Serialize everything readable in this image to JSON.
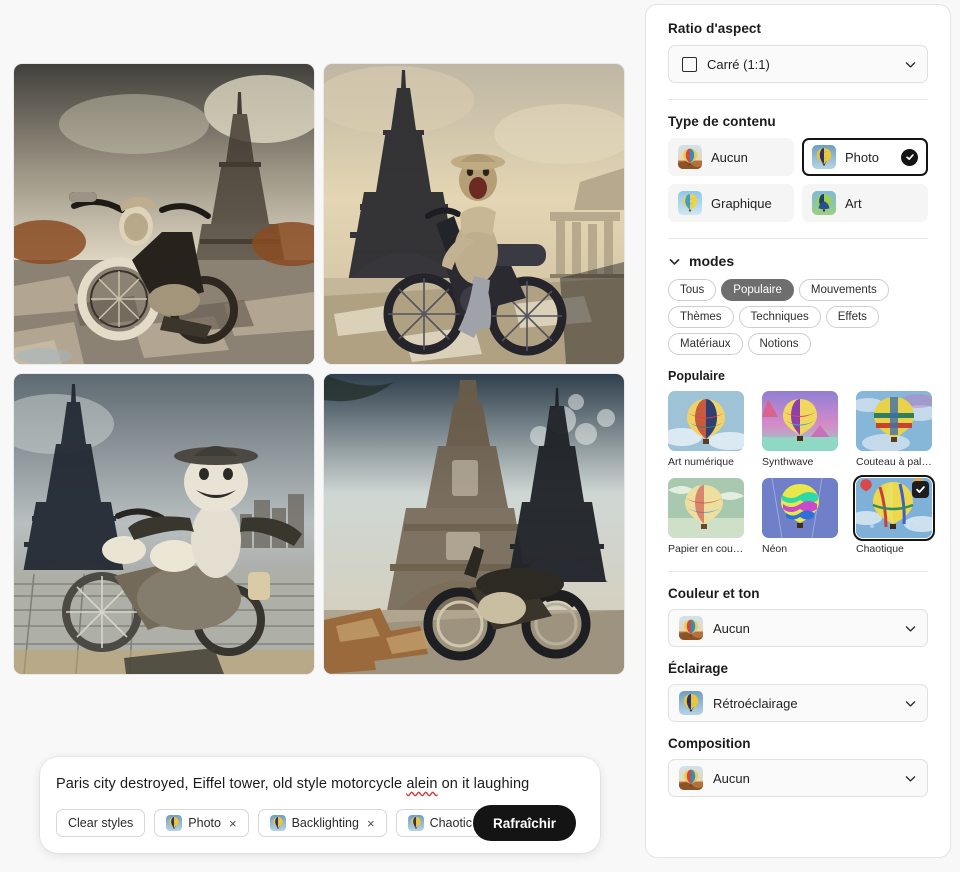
{
  "results": {
    "images": [
      {
        "alt": "Paris destroyed with Eiffel tower and old style motorcycle, rider laughing, sepia tone"
      },
      {
        "alt": "Laughing character riding motorcycle in front of Eiffel tower with ruins"
      },
      {
        "alt": "Puppet character with hat on motorcycle near Eiffel tower, misty"
      },
      {
        "alt": "Two Eiffel towers with motorcycle and debris, blue sky"
      }
    ]
  },
  "prompt": {
    "text_before": "Paris city destroyed, Eiffel tower, old style motorcycle ",
    "misspelled_word": "alein",
    "text_after": " on it laughing",
    "full_text": "Paris city destroyed, Eiffel tower, old style motorcycle alein on it laughing",
    "clear_styles_label": "Clear styles",
    "chips": [
      {
        "label": "Photo",
        "remove_label": "×"
      },
      {
        "label": "Backlighting",
        "remove_label": "×"
      },
      {
        "label": "Chaotic",
        "remove_label": "×"
      }
    ],
    "refresh_label": "Rafraîchir"
  },
  "panel": {
    "aspect_ratio": {
      "title": "Ratio d'aspect",
      "value": "Carré (1:1)"
    },
    "content_type": {
      "title": "Type de contenu",
      "options": [
        {
          "label": "Aucun",
          "selected": false
        },
        {
          "label": "Photo",
          "selected": true
        },
        {
          "label": "Graphique",
          "selected": false
        },
        {
          "label": "Art",
          "selected": false
        }
      ]
    },
    "modes": {
      "title": "modes",
      "pills": [
        {
          "label": "Tous",
          "active": false
        },
        {
          "label": "Populaire",
          "active": true
        },
        {
          "label": "Mouvements",
          "active": false
        },
        {
          "label": "Thèmes",
          "active": false
        },
        {
          "label": "Techniques",
          "active": false
        },
        {
          "label": "Effets",
          "active": false
        },
        {
          "label": "Matériaux",
          "active": false
        },
        {
          "label": "Notions",
          "active": false
        }
      ],
      "group_title": "Populaire",
      "styles": [
        {
          "label": "Art numérique",
          "selected": false
        },
        {
          "label": "Synthwave",
          "selected": false
        },
        {
          "label": "Couteau à pale...",
          "selected": false
        },
        {
          "label": "Papier en couc...",
          "selected": false
        },
        {
          "label": "Néon",
          "selected": false
        },
        {
          "label": "Chaotique",
          "selected": true
        }
      ]
    },
    "color_tone": {
      "title": "Couleur et ton",
      "value": "Aucun"
    },
    "lighting": {
      "title": "Éclairage",
      "value": "Rétroéclairage"
    },
    "composition": {
      "title": "Composition",
      "value": "Aucun"
    }
  },
  "colors": {
    "page_background": "#f8f8f8",
    "panel_background": "#ffffff",
    "accent_dark": "#141414",
    "pill_active": "#6e6e6e",
    "border": "#e0e0e0",
    "spell_error": "#d13d3d"
  }
}
